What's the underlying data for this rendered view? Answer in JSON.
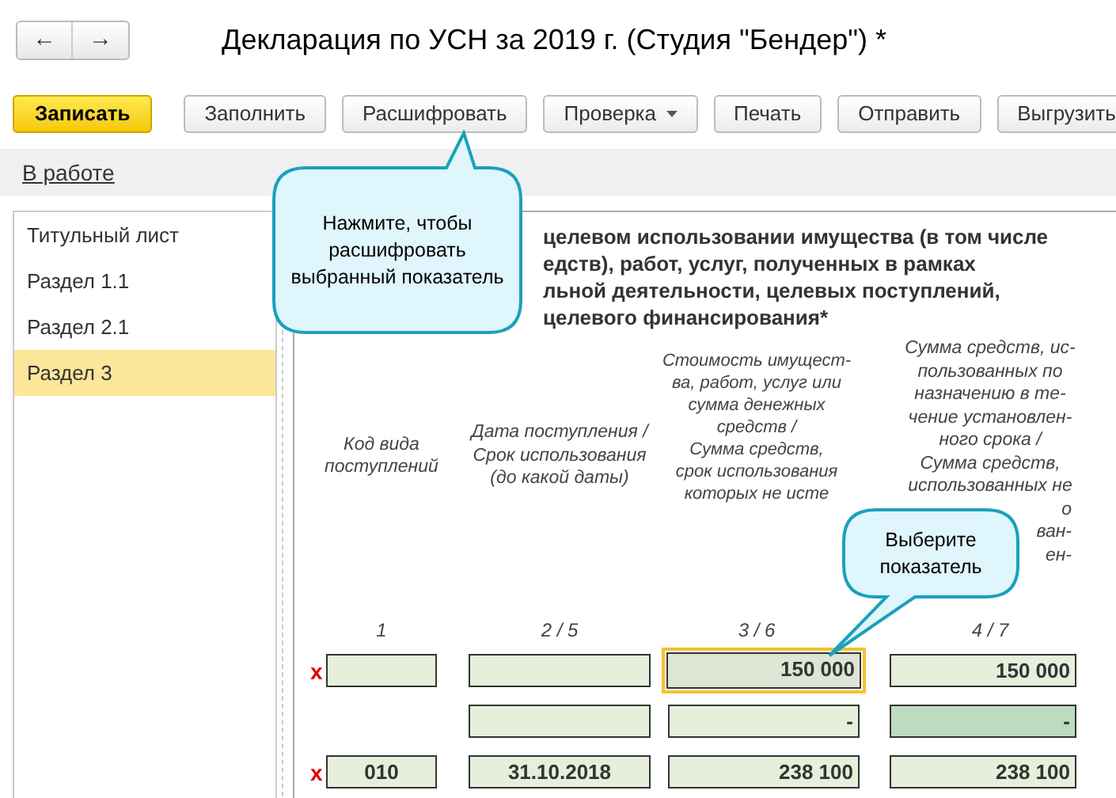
{
  "window": {
    "title": "Декларация по УСН за 2019 г. (Студия \"Бендер\") *"
  },
  "nav": {
    "back": "←",
    "forward": "→"
  },
  "toolbar": [
    {
      "label": "Записать",
      "kind": "primary"
    },
    {
      "label": "Заполнить",
      "kind": "plain"
    },
    {
      "label": "Расшифровать",
      "kind": "plain"
    },
    {
      "label": "Проверка",
      "kind": "dropdown"
    },
    {
      "label": "Печать",
      "kind": "plain"
    },
    {
      "label": "Отправить",
      "kind": "plain"
    },
    {
      "label": "Выгрузить",
      "kind": "plain"
    }
  ],
  "status": {
    "label": "В работе"
  },
  "sidebar": {
    "items": [
      {
        "label": "Титульный лист",
        "selected": false
      },
      {
        "label": "Раздел 1.1",
        "selected": false
      },
      {
        "label": "Раздел 2.1",
        "selected": false
      },
      {
        "label": "Раздел 3",
        "selected": true
      }
    ]
  },
  "section": {
    "heading_lines": [
      "целевом использовании имущества (в том числе",
      "едств), работ, услуг, полученных в рамках",
      "льной деятельности, целевых поступлений,",
      "целевого финансирования*"
    ],
    "columns": [
      {
        "lines": [
          "Код вида",
          "поступлений"
        ],
        "number": "1"
      },
      {
        "lines": [
          "Дата поступления /",
          "Срок использования",
          "(до какой даты)"
        ],
        "number": "2 / 5"
      },
      {
        "lines": [
          "Стоимость имущест-",
          "ва, работ, услуг или",
          "сумма денежных",
          "средств /",
          "Сумма средств,",
          "срок использования",
          "которых не исте"
        ],
        "number": "3 / 6"
      },
      {
        "lines": [
          "Сумма средств, ис-",
          "пользованных по",
          "назначению в те-",
          "чение установлен-",
          "ного срока /",
          "Сумма средств,",
          "использованных не"
        ],
        "cut_lines": [
          "о",
          "ван-",
          "ен-"
        ],
        "number": "4 / 7"
      }
    ],
    "rows": [
      {
        "mark": "x",
        "cells": [
          {
            "kind": "input",
            "selected": false
          },
          {
            "kind": "input",
            "selected": false
          },
          {
            "kind": "input",
            "value": "150 000",
            "selected": true
          },
          {
            "kind": "input",
            "value": "150 000",
            "selected": false
          }
        ]
      },
      {
        "cells": [
          {
            "kind": "none",
            "selected": false
          },
          {
            "kind": "input",
            "selected": false
          },
          {
            "kind": "input",
            "value": "-",
            "selected": false
          },
          {
            "kind": "computed",
            "value": "-",
            "selected": false
          }
        ]
      },
      {
        "mark": "x",
        "cells": [
          {
            "kind": "input",
            "value": "010",
            "selected": false
          },
          {
            "kind": "input",
            "value": "31.10.2018",
            "selected": false
          },
          {
            "kind": "input",
            "value": "238 100",
            "selected": false
          },
          {
            "kind": "input",
            "value": "238 100",
            "selected": false
          }
        ]
      }
    ]
  },
  "callouts": [
    {
      "text_lines": [
        "Нажмите, чтобы",
        "расшифровать",
        "выбранный показатель"
      ]
    },
    {
      "text_lines": [
        "Выберите",
        "показатель"
      ]
    }
  ]
}
